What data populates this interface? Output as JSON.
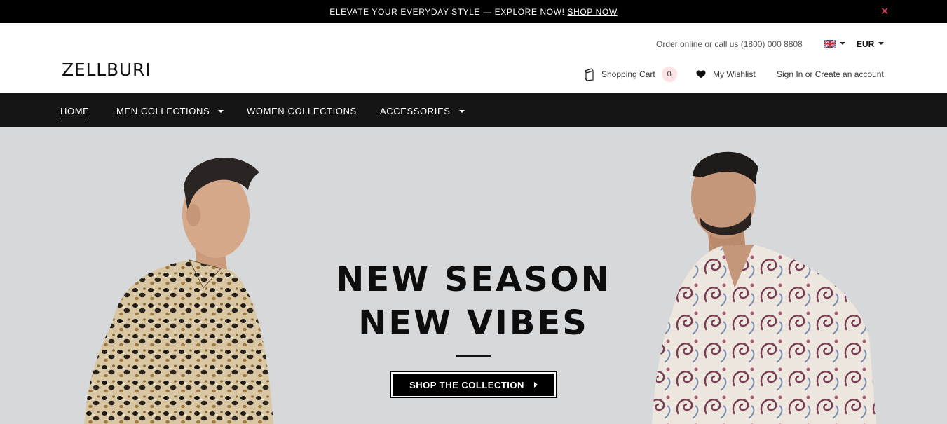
{
  "announcement": {
    "message": "Elevate your everyday style — explore now!",
    "link_label": "Shop now",
    "close_symbol": "✕"
  },
  "header": {
    "logo": "ZELLBURI",
    "contact": "Order online or call us (1800) 000 8808",
    "language_icon": "uk-flag-icon",
    "currency": "EUR",
    "cart": {
      "label": "Shopping Cart",
      "count": "0",
      "icon": "cart-icon"
    },
    "wishlist": {
      "label": "My Wishlist",
      "icon": "heart-icon"
    },
    "account": "Sign In or Create an account"
  },
  "nav": {
    "items": [
      {
        "label": "Home",
        "active": true,
        "dropdown": false
      },
      {
        "label": "Men Collections",
        "active": false,
        "dropdown": true
      },
      {
        "label": "Women Collections",
        "active": false,
        "dropdown": false
      },
      {
        "label": "Accessories",
        "active": false,
        "dropdown": true
      }
    ]
  },
  "hero": {
    "title_line1": "NEW SEASON",
    "title_line2": "NEW VIBES",
    "button_label": "Shop the collection",
    "background": "#d7d8da"
  },
  "colors": {
    "announcement_bg": "#000000",
    "nav_bg": "#151515",
    "close_accent": "#e3415a",
    "cart_badge": "#fde3e6"
  }
}
